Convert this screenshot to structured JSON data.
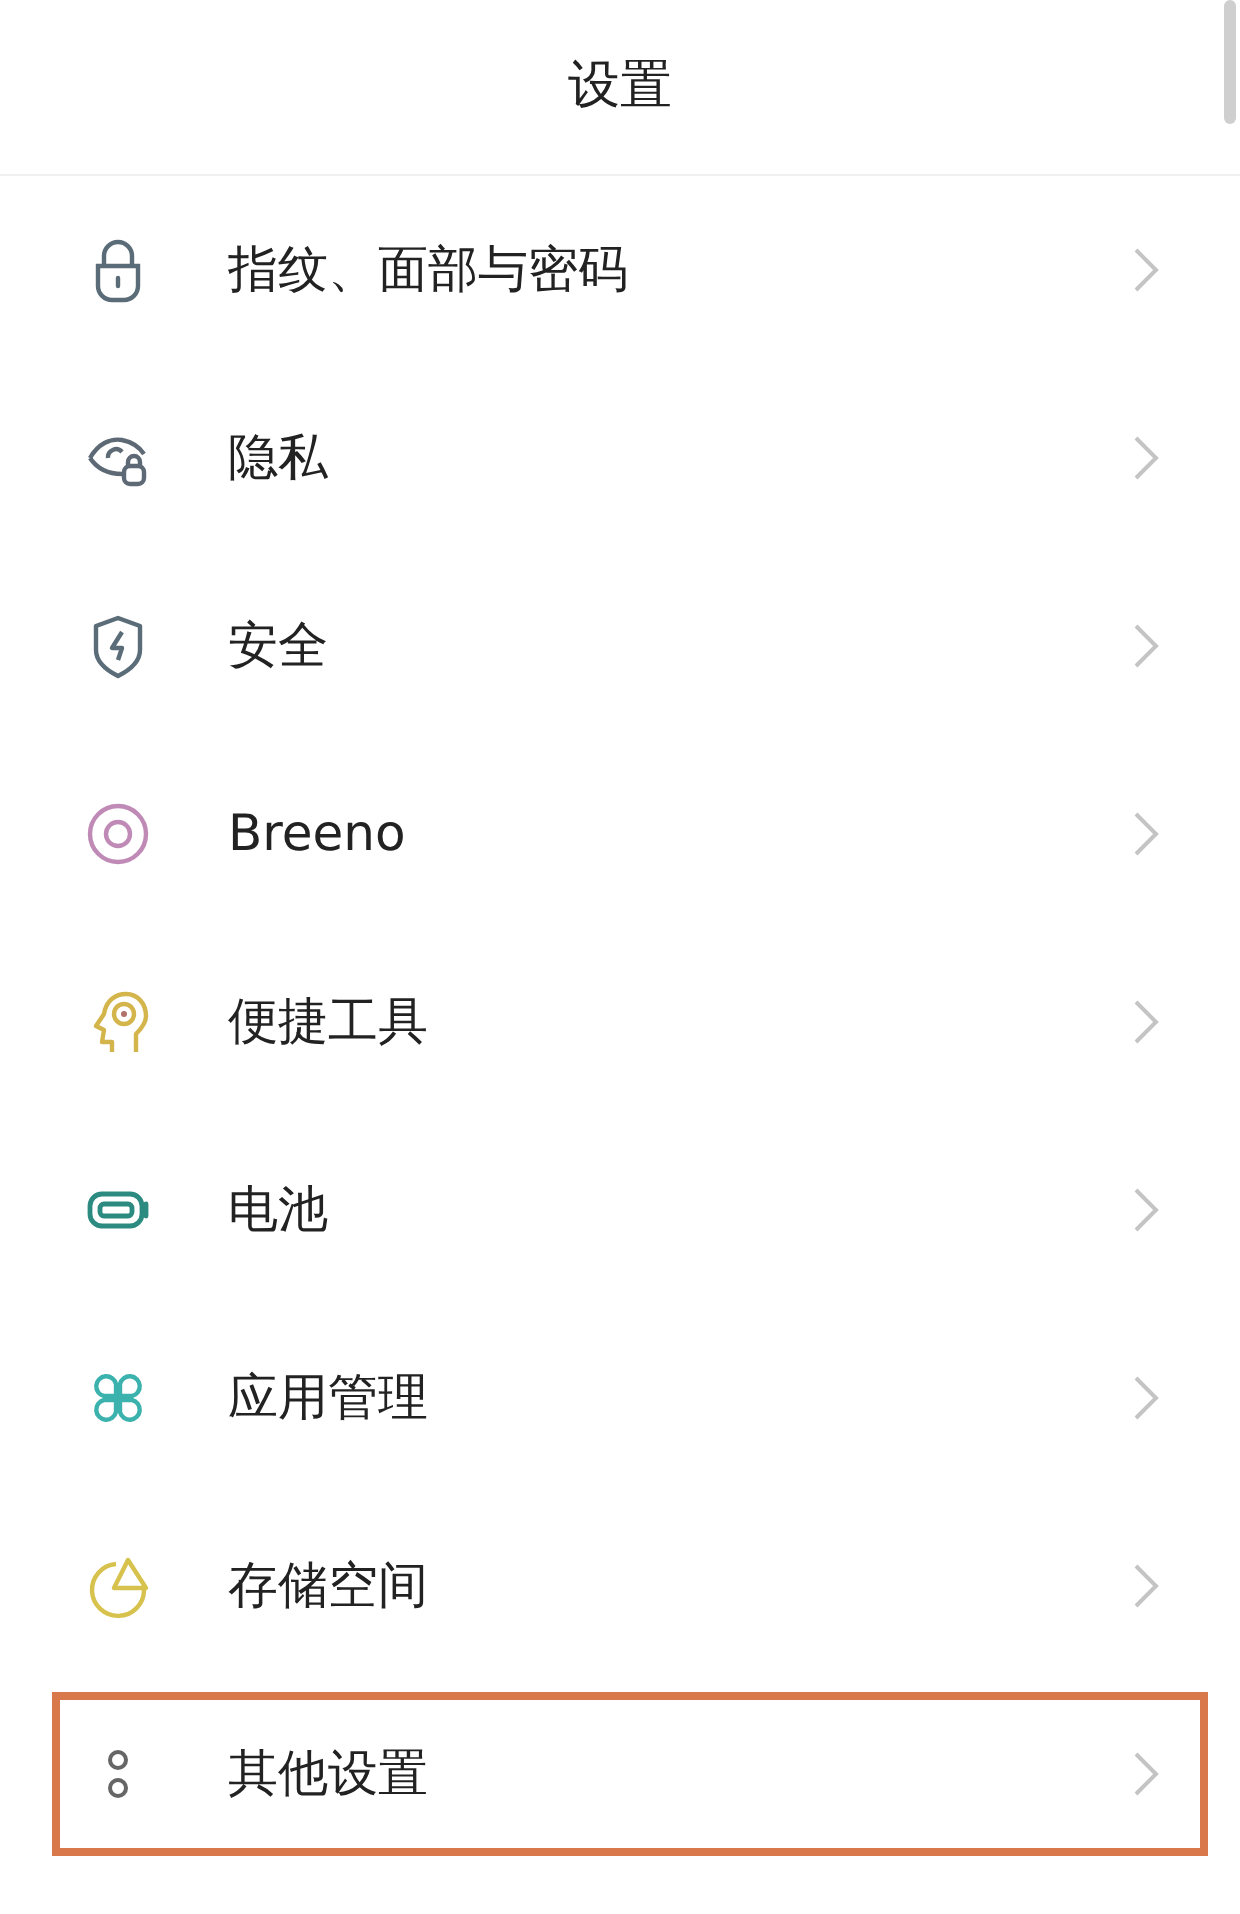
{
  "header": {
    "title": "设置"
  },
  "items": [
    {
      "kind": "lock",
      "label": "指纹、面部与密码",
      "highlighted": false
    },
    {
      "kind": "privacy",
      "label": "隐私",
      "highlighted": false
    },
    {
      "kind": "security",
      "label": "安全",
      "highlighted": false
    },
    {
      "kind": "breeno",
      "label": "Breeno",
      "highlighted": false
    },
    {
      "kind": "tools",
      "label": "便捷工具",
      "highlighted": false
    },
    {
      "kind": "battery",
      "label": "电池",
      "highlighted": false
    },
    {
      "kind": "apps",
      "label": "应用管理",
      "highlighted": false
    },
    {
      "kind": "storage",
      "label": "存储空间",
      "highlighted": false
    },
    {
      "kind": "more",
      "label": "其他设置",
      "highlighted": true
    }
  ]
}
